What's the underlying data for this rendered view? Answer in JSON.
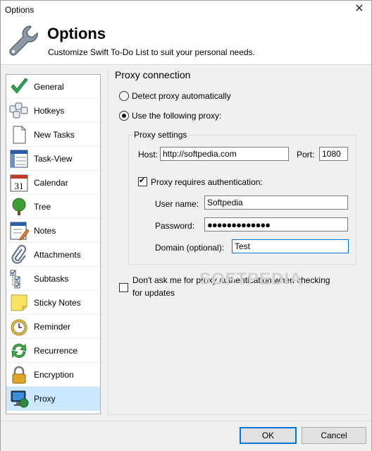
{
  "window": {
    "title": "Options",
    "close_glyph": "✕"
  },
  "header": {
    "title": "Options",
    "subtitle": "Customize Swift To-Do List to suit your personal needs.",
    "icon": "wrench-icon"
  },
  "sidebar": {
    "items": [
      {
        "label": "General",
        "icon": "green-check-icon",
        "selected": false
      },
      {
        "label": "Hotkeys",
        "icon": "keyboard-icon",
        "selected": false
      },
      {
        "label": "New Tasks",
        "icon": "blank-page-icon",
        "selected": false
      },
      {
        "label": "Task-View",
        "icon": "task-view-icon",
        "selected": false
      },
      {
        "label": "Calendar",
        "icon": "calendar-icon",
        "selected": false
      },
      {
        "label": "Tree",
        "icon": "tree-icon",
        "selected": false
      },
      {
        "label": "Notes",
        "icon": "notes-icon",
        "selected": false
      },
      {
        "label": "Attachments",
        "icon": "paperclip-icon",
        "selected": false
      },
      {
        "label": "Subtasks",
        "icon": "subtasks-icon",
        "selected": false
      },
      {
        "label": "Sticky Notes",
        "icon": "sticky-note-icon",
        "selected": false
      },
      {
        "label": "Reminder",
        "icon": "alarm-clock-icon",
        "selected": false
      },
      {
        "label": "Recurrence",
        "icon": "recurrence-arrows-icon",
        "selected": false
      },
      {
        "label": "Encryption",
        "icon": "padlock-icon",
        "selected": false
      },
      {
        "label": "Proxy",
        "icon": "monitor-globe-icon",
        "selected": true
      }
    ],
    "calendar_day": "31"
  },
  "proxy": {
    "group_title": "Proxy connection",
    "detect_auto_label": "Detect proxy automatically",
    "use_following_label": "Use the following proxy:",
    "selected_option": "use_following",
    "settings_title": "Proxy settings",
    "host_label": "Host:",
    "host_value": "http://softpedia.com",
    "port_label": "Port:",
    "port_value": "1080",
    "auth_label": "Proxy requires authentication:",
    "auth_checked": true,
    "username_label": "User name:",
    "username_value": "Softpedia",
    "password_label": "Password:",
    "password_value": "●●●●●●●●●●●●●",
    "domain_label": "Domain (optional):",
    "domain_value": "Test",
    "dont_ask_line1": "Don't ask me for proxy authentication when checking",
    "dont_ask_line2": "for updates",
    "dont_ask_checked": false,
    "watermark": "SOFTPEDIA"
  },
  "buttons": {
    "ok": "OK",
    "cancel": "Cancel"
  },
  "colors": {
    "selected_bg": "#cce8ff",
    "focus_border": "#0078d7"
  }
}
